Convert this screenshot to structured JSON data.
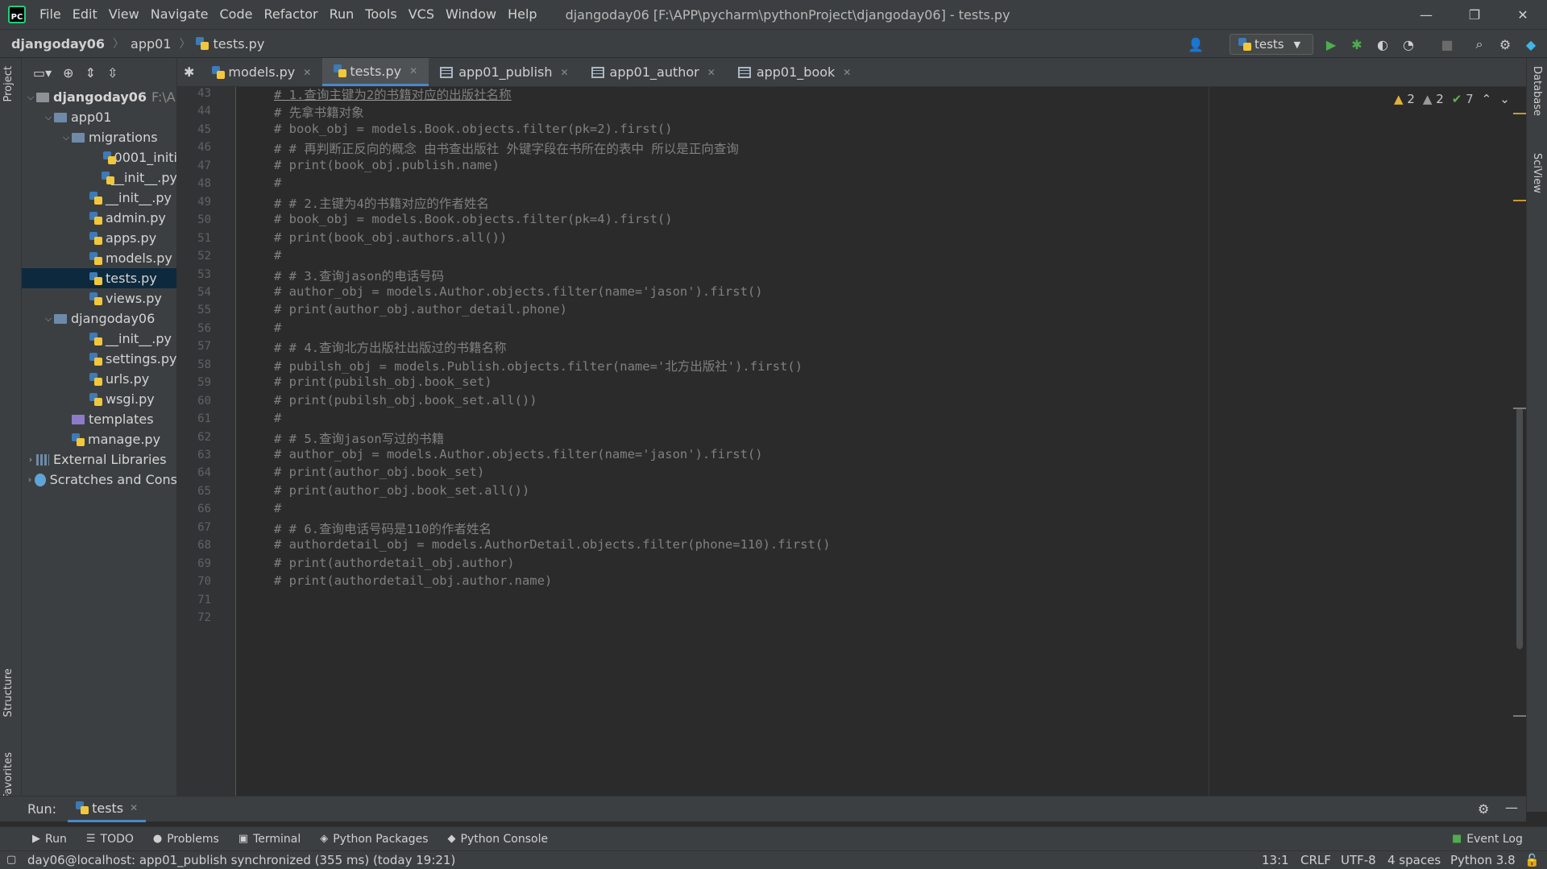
{
  "menu": [
    "File",
    "Edit",
    "View",
    "Navigate",
    "Code",
    "Refactor",
    "Run",
    "Tools",
    "VCS",
    "Window",
    "Help"
  ],
  "window_title": "djangoday06 [F:\\APP\\pycharm\\pythonProject\\djangoday06] - tests.py",
  "breadcrumb": [
    "djangoday06",
    "app01",
    "tests.py"
  ],
  "run_config": "tests",
  "tabs": [
    {
      "label": "models.py",
      "icon": "python-file-icon"
    },
    {
      "label": "tests.py",
      "icon": "python-file-icon",
      "active": true
    },
    {
      "label": "app01_publish",
      "icon": "table-icon"
    },
    {
      "label": "app01_author",
      "icon": "table-icon"
    },
    {
      "label": "app01_book",
      "icon": "table-icon"
    }
  ],
  "side_labels": {
    "project": "Project",
    "structure": "Structure",
    "favorites": "Favorites",
    "database": "Database",
    "sciview": "SciView"
  },
  "tree": [
    {
      "label": "djangoday06",
      "hint": "F:\\A",
      "type": "folder",
      "depth": 0,
      "expanded": true
    },
    {
      "label": "app01",
      "type": "folder",
      "depth": 1,
      "expanded": true
    },
    {
      "label": "migrations",
      "type": "folder",
      "depth": 2,
      "expanded": true
    },
    {
      "label": "0001_initi",
      "type": "py",
      "depth": 4
    },
    {
      "label": "__init__.py",
      "type": "py",
      "depth": 4
    },
    {
      "label": "__init__.py",
      "type": "py",
      "depth": 3
    },
    {
      "label": "admin.py",
      "type": "py",
      "depth": 3
    },
    {
      "label": "apps.py",
      "type": "py",
      "depth": 3
    },
    {
      "label": "models.py",
      "type": "py",
      "depth": 3
    },
    {
      "label": "tests.py",
      "type": "py",
      "depth": 3,
      "selected": true
    },
    {
      "label": "views.py",
      "type": "py",
      "depth": 3
    },
    {
      "label": "djangoday06",
      "type": "folder",
      "depth": 1,
      "expanded": true
    },
    {
      "label": "__init__.py",
      "type": "py",
      "depth": 3
    },
    {
      "label": "settings.py",
      "type": "py",
      "depth": 3
    },
    {
      "label": "urls.py",
      "type": "py",
      "depth": 3
    },
    {
      "label": "wsgi.py",
      "type": "py",
      "depth": 3
    },
    {
      "label": "templates",
      "type": "folder-purple",
      "depth": 2
    },
    {
      "label": "manage.py",
      "type": "py",
      "depth": 2
    },
    {
      "label": "External Libraries",
      "type": "lib",
      "depth": 0,
      "collapsed": true
    },
    {
      "label": "Scratches and Cons",
      "type": "scratch",
      "depth": 0,
      "collapsed": true
    }
  ],
  "code_lines": [
    {
      "n": "43",
      "text": "# 1.查询主键为2的书籍对应的出版社名称",
      "underline": true
    },
    {
      "n": "44",
      "text": "# 先拿书籍对象"
    },
    {
      "n": "45",
      "text": "# book_obj = models.Book.objects.filter(pk=2).first()"
    },
    {
      "n": "46",
      "text": "# # 再判断正反向的概念 由书查出版社 外键字段在书所在的表中 所以是正向查询"
    },
    {
      "n": "47",
      "text": "# print(book_obj.publish.name)"
    },
    {
      "n": "48",
      "text": "#"
    },
    {
      "n": "49",
      "text": "# # 2.主键为4的书籍对应的作者姓名"
    },
    {
      "n": "50",
      "text": "# book_obj = models.Book.objects.filter(pk=4).first()"
    },
    {
      "n": "51",
      "text": "# print(book_obj.authors.all())"
    },
    {
      "n": "52",
      "text": "#"
    },
    {
      "n": "53",
      "text": "# # 3.查询jason的电话号码"
    },
    {
      "n": "54",
      "text": "# author_obj = models.Author.objects.filter(name='jason').first()"
    },
    {
      "n": "55",
      "text": "# print(author_obj.author_detail.phone)"
    },
    {
      "n": "56",
      "text": "#"
    },
    {
      "n": "57",
      "text": "# # 4.查询北方出版社出版过的书籍名称"
    },
    {
      "n": "58",
      "text": "# pubilsh_obj = models.Publish.objects.filter(name='北方出版社').first()"
    },
    {
      "n": "59",
      "text": "# print(pubilsh_obj.book_set)"
    },
    {
      "n": "60",
      "text": "# print(pubilsh_obj.book_set.all())"
    },
    {
      "n": "61",
      "text": "#"
    },
    {
      "n": "62",
      "text": "# # 5.查询jason写过的书籍"
    },
    {
      "n": "63",
      "text": "# author_obj = models.Author.objects.filter(name='jason').first()"
    },
    {
      "n": "64",
      "text": "# print(author_obj.book_set)"
    },
    {
      "n": "65",
      "text": "# print(author_obj.book_set.all())"
    },
    {
      "n": "66",
      "text": "#"
    },
    {
      "n": "67",
      "text": "# # 6.查询电话号码是110的作者姓名"
    },
    {
      "n": "68",
      "text": "# authordetail_obj = models.AuthorDetail.objects.filter(phone=110).first()"
    },
    {
      "n": "69",
      "text": "# print(authordetail_obj.author)"
    },
    {
      "n": "70",
      "text": "# print(authordetail_obj.author.name)"
    },
    {
      "n": "71",
      "text": ""
    },
    {
      "n": "72",
      "text": ""
    }
  ],
  "inspections": {
    "warnings": "2",
    "weak_warnings": "2",
    "typos": "7"
  },
  "run_panel": {
    "label": "Run:",
    "tab": "tests"
  },
  "tool_windows": [
    "Run",
    "TODO",
    "Problems",
    "Terminal",
    "Python Packages",
    "Python Console"
  ],
  "event_log": "Event Log",
  "status": {
    "message": "day06@localhost: app01_publish synchronized (355 ms) (today 19:21)",
    "position": "13:1",
    "line_sep": "CRLF",
    "encoding": "UTF-8",
    "indent": "4 spaces",
    "interpreter": "Python 3.8"
  },
  "colors": {
    "accent": "#4a88c7",
    "bg": "#2b2b2b",
    "panel": "#3c3f41",
    "comment": "#808080",
    "warning": "#e0b23a"
  }
}
